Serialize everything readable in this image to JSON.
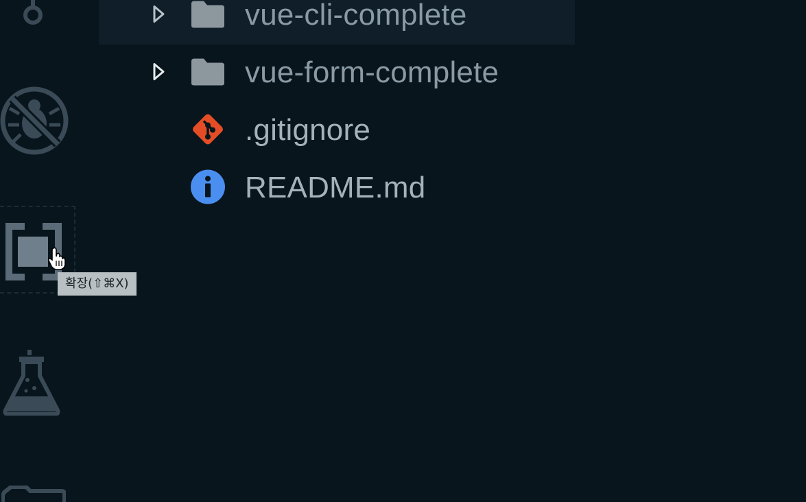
{
  "activity_bar": {
    "items": [
      {
        "name": "source-control",
        "icon": "git-branch-icon"
      },
      {
        "name": "debug-disabled",
        "icon": "no-bug-icon"
      },
      {
        "name": "extensions",
        "icon": "extensions-icon",
        "hovered": true
      },
      {
        "name": "test",
        "icon": "flask-icon"
      },
      {
        "name": "remote-explorer",
        "icon": "folder-icon"
      }
    ],
    "tooltip": "확장(⇧⌘X)"
  },
  "explorer": {
    "items": [
      {
        "label": "vue-cli-complete",
        "type": "folder",
        "selected": true
      },
      {
        "label": "vue-form-complete",
        "type": "folder"
      },
      {
        "label": ".gitignore",
        "type": "file",
        "icon": "git-icon"
      },
      {
        "label": "README.md",
        "type": "file",
        "icon": "info-icon"
      }
    ]
  },
  "colors": {
    "background": "#08151c",
    "selected_row": "#0f1e29",
    "icon_gray": "#3a4a56",
    "folder_gray": "#8d979e",
    "git_orange": "#e44d26",
    "info_blue": "#4a8ff0"
  }
}
